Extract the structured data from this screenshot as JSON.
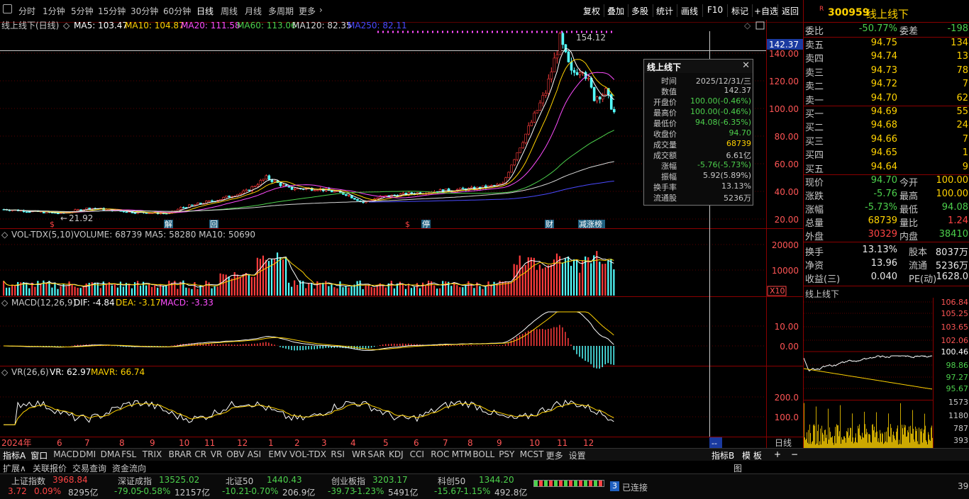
{
  "toolbar": {
    "periods": [
      "分时",
      "1分钟",
      "5分钟",
      "15分钟",
      "30分钟",
      "60分钟",
      "日线",
      "周线",
      "月线",
      "多周期",
      "更多"
    ],
    "active": "日线",
    "right_buttons": [
      "复权",
      "叠加",
      "多股",
      "统计",
      "画线",
      "F10",
      "标记",
      "+自选",
      "返回"
    ]
  },
  "main_chart": {
    "title": "线上线下(日线)",
    "ma": [
      {
        "label": "MA5: 103.47",
        "color": "#ffffff"
      },
      {
        "label": "MA10: 104.87",
        "color": "#ffd200"
      },
      {
        "label": "MA20: 111.58",
        "color": "#ff4dff"
      },
      {
        "label": "MA60: 113.06",
        "color": "#4cd04c"
      },
      {
        "label": "MA120: 82.35",
        "color": "#d8d8d8"
      },
      {
        "label": "MA250: 82.11",
        "color": "#4a4aff"
      }
    ],
    "y_ticks": [
      "140.00",
      "120.00",
      "100.00",
      "80.00",
      "60.00",
      "40.00",
      "20.00"
    ],
    "cursor_price": "142.37",
    "high_label": "154.12",
    "low_label": "21.92",
    "event_markers": [
      {
        "text": "$",
        "color": "#ff4444"
      },
      {
        "text": "解",
        "color": "#ffffff"
      },
      {
        "text": "回",
        "color": "#ffffff"
      },
      {
        "text": "$",
        "color": "#ff4444"
      },
      {
        "text": "停",
        "color": "#ffffff"
      },
      {
        "text": "财",
        "color": "#ffffff"
      },
      {
        "text": "减涨榜",
        "color": "#ffffff"
      }
    ]
  },
  "tooltip": {
    "title": "线上线下",
    "rows": [
      {
        "label": "时间",
        "value": "2025/12/31/三",
        "color": "#c8c8c8"
      },
      {
        "label": "数值",
        "value": "142.37",
        "color": "#c8c8c8"
      },
      {
        "label": "开盘价",
        "value": "100.00(-0.46%)",
        "color": "#4cd04c"
      },
      {
        "label": "最高价",
        "value": "100.00(-0.46%)",
        "color": "#4cd04c"
      },
      {
        "label": "最低价",
        "value": "94.08(-6.35%)",
        "color": "#4cd04c"
      },
      {
        "label": "收盘价",
        "value": "94.70",
        "color": "#4cd04c"
      },
      {
        "label": "成交量",
        "value": "68739",
        "color": "#ffd200"
      },
      {
        "label": "成交额",
        "value": "6.61亿",
        "color": "#c8c8c8"
      },
      {
        "label": "涨幅",
        "value": "-5.76(-5.73%)",
        "color": "#4cd04c"
      },
      {
        "label": "振幅",
        "value": "5.92(5.89%)",
        "color": "#c8c8c8"
      },
      {
        "label": "换手率",
        "value": "13.13%",
        "color": "#c8c8c8"
      },
      {
        "label": "流通股",
        "value": "5236万",
        "color": "#c8c8c8"
      }
    ]
  },
  "vol_panel": {
    "title": "VOL-TDX(5,10)",
    "values": "VOLUME: 68739  MA5: 58280  MA10: 50690",
    "y_ticks": [
      "20000",
      "10000"
    ],
    "unit": "X10"
  },
  "macd_panel": {
    "title": "MACD(12,26,9)",
    "dif": "DIF: -4.84",
    "dea": "DEA: -3.17",
    "macd": "MACD: -3.33",
    "y_ticks": [
      "10.00",
      "0.00"
    ]
  },
  "vr_panel": {
    "title": "VR(26,6)",
    "vr": "VR: 62.97",
    "mavr": "MAVR: 66.74",
    "y_ticks": [
      "200.0",
      "100.0"
    ]
  },
  "x_axis": {
    "labels": [
      "2024年",
      "6",
      "7",
      "8",
      "9",
      "10",
      "11",
      "12",
      "1",
      "2",
      "3",
      "4",
      "5",
      "6",
      "7",
      "8",
      "9",
      "10",
      "11",
      "12"
    ],
    "period_label": "日线",
    "cursor_label": "--"
  },
  "right_panel": {
    "code": "300959",
    "name": "线上线下",
    "badge": "R",
    "weibi_label": "委比",
    "weibi": "-50.77%",
    "weicha_label": "委差",
    "weicha": "-198",
    "sell": [
      {
        "label": "卖五",
        "price": "94.75",
        "vol": "134"
      },
      {
        "label": "卖四",
        "price": "94.74",
        "vol": "13"
      },
      {
        "label": "卖三",
        "price": "94.73",
        "vol": "78"
      },
      {
        "label": "卖二",
        "price": "94.72",
        "vol": "7"
      },
      {
        "label": "卖一",
        "price": "94.70",
        "vol": "62"
      }
    ],
    "buy": [
      {
        "label": "买一",
        "price": "94.69",
        "vol": "55"
      },
      {
        "label": "买二",
        "price": "94.68",
        "vol": "24"
      },
      {
        "label": "买三",
        "price": "94.66",
        "vol": "7"
      },
      {
        "label": "买四",
        "price": "94.65",
        "vol": "1"
      },
      {
        "label": "买五",
        "price": "94.64",
        "vol": "9"
      }
    ],
    "quote": [
      {
        "l1": "现价",
        "v1": "94.70",
        "c1": "green",
        "l2": "今开",
        "v2": "100.00",
        "c2": "yellow"
      },
      {
        "l1": "涨跌",
        "v1": "-5.76",
        "c1": "green",
        "l2": "最高",
        "v2": "100.00",
        "c2": "yellow"
      },
      {
        "l1": "涨幅",
        "v1": "-5.73%",
        "c1": "green",
        "l2": "最低",
        "v2": "94.08",
        "c2": "green"
      },
      {
        "l1": "总量",
        "v1": "68739",
        "c1": "yellow",
        "l2": "量比",
        "v2": "1.24",
        "c2": "red"
      },
      {
        "l1": "外盘",
        "v1": "30329",
        "c1": "red",
        "l2": "内盘",
        "v2": "38410",
        "c2": "green"
      }
    ],
    "fin": [
      {
        "l1": "换手",
        "v1": "13.13%",
        "l2": "股本",
        "v2": "8037万"
      },
      {
        "l1": "净资",
        "v1": "13.96",
        "l2": "流通",
        "v2": "5236万"
      },
      {
        "l1": "收益(三)",
        "v1": "0.040",
        "l2": "PE(动)",
        "v2": "1628.0"
      }
    ],
    "mini_title": "线上线下",
    "mini_price_ticks": [
      "106.84",
      "105.25",
      "103.65",
      "102.06",
      "100.46",
      "98.86",
      "97.27",
      "95.67"
    ],
    "mini_vol_ticks": [
      "1573",
      "1180",
      "787",
      "393"
    ]
  },
  "indicator_tabs": [
    "指标A",
    "窗口",
    "MACD",
    "DMI",
    "DMA",
    "FSL",
    "TRIX",
    "BRAR",
    "CR",
    "VR",
    "OBV",
    "ASI",
    "EMV",
    "VOL-TDX",
    "RSI",
    "WR",
    "SAR",
    "KDJ",
    "CCI",
    "ROC",
    "MTM",
    "BOLL",
    "PSY",
    "MCST",
    "更多",
    "设置"
  ],
  "indicator_right": [
    "指标B",
    "模 板",
    "+",
    "−"
  ],
  "sub_tabs": [
    "扩展∧",
    "关联报价",
    "交易查询",
    "资金流向"
  ],
  "sub_tabs_right": "图",
  "status": {
    "indices": [
      {
        "name": "上证指数",
        "value": "3968.84",
        "chg": "3.72",
        "pct": "0.09%",
        "amt": "8295亿",
        "color": "#ff4444"
      },
      {
        "name": "深证成指",
        "value": "13525.02",
        "chg": "-79.05",
        "pct": "-0.58%",
        "amt": "12157亿",
        "color": "#4cd04c"
      },
      {
        "name": "北证50",
        "value": "1440.43",
        "chg": "-10.21",
        "pct": "-0.70%",
        "amt": "206.9亿",
        "color": "#4cd04c"
      },
      {
        "name": "创业板指",
        "value": "3203.17",
        "chg": "-39.73",
        "pct": "-1.23%",
        "amt": "5491亿",
        "color": "#4cd04c"
      },
      {
        "name": "科创50",
        "value": "1344.20",
        "chg": "-15.67",
        "pct": "-1.15%",
        "amt": "492.8亿",
        "color": "#4cd04c"
      }
    ],
    "conn_num": "3",
    "conn_text": "已连接",
    "right_num": "39"
  }
}
